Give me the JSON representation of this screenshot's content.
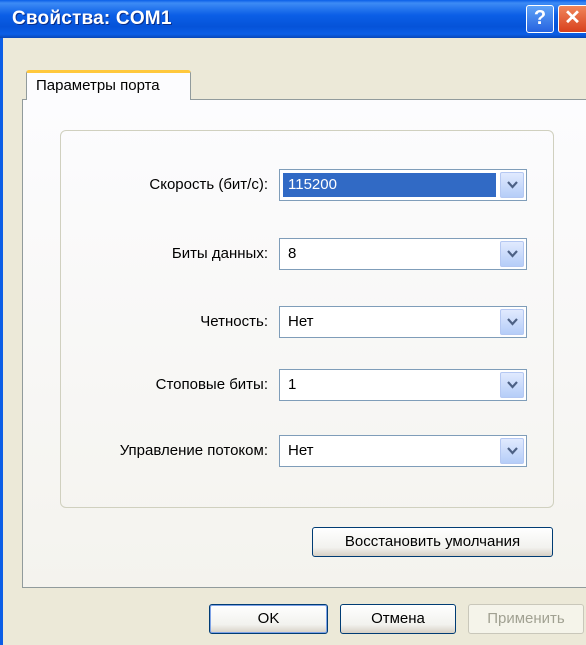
{
  "window": {
    "title": "Свойства: COM1",
    "help_glyph": "?",
    "close_glyph": "✕"
  },
  "tabs": [
    {
      "label": "Параметры порта",
      "selected": true
    }
  ],
  "fields": [
    {
      "label": "Скорость (бит/с):",
      "value": "115200",
      "selected": true
    },
    {
      "label": "Биты данных:",
      "value": "8",
      "selected": false
    },
    {
      "label": "Четность:",
      "value": "Нет",
      "selected": false
    },
    {
      "label": "Стоповые биты:",
      "value": "1",
      "selected": false
    },
    {
      "label": "Управление потоком:",
      "value": "Нет",
      "selected": false
    }
  ],
  "restore_defaults_label": "Восстановить умолчания",
  "footer": {
    "ok_label": "OK",
    "cancel_label": "Отмена",
    "apply_label": "Применить"
  },
  "colors": {
    "titlebar": "#0B5EE6",
    "selection": "#316AC5",
    "face": "#ECE9D8"
  },
  "icons": {
    "help": "question-mark-icon",
    "close": "close-icon",
    "dropdown": "chevron-down-icon"
  }
}
